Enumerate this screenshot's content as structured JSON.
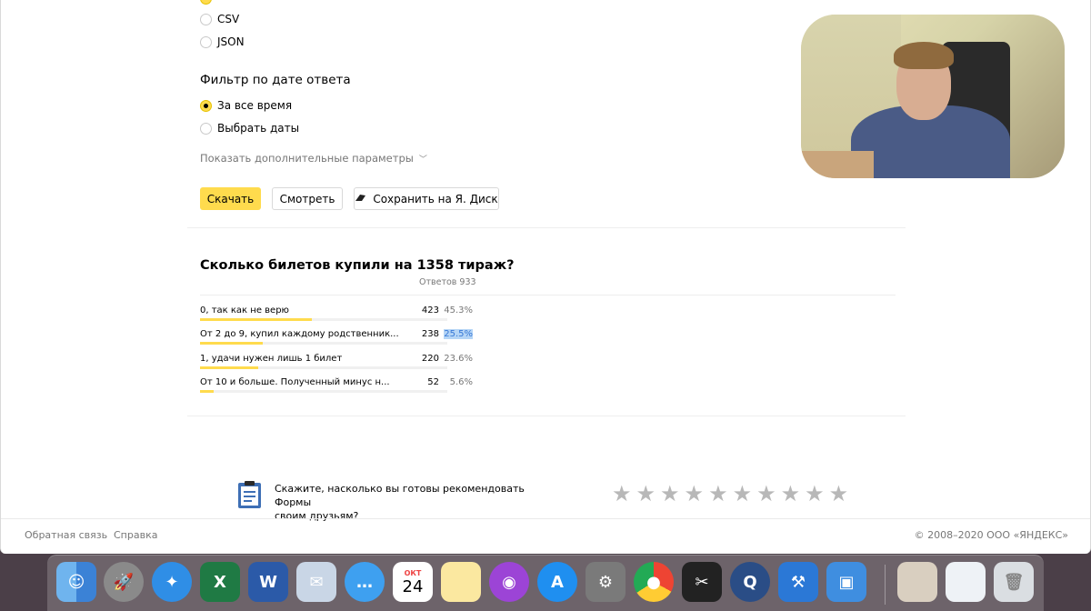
{
  "format_options": [
    {
      "label": "CSV",
      "checked": false
    },
    {
      "label": "JSON",
      "checked": false
    }
  ],
  "filter": {
    "title": "Фильтр по дате ответа",
    "options": [
      {
        "label": "За все время",
        "checked": true
      },
      {
        "label": "Выбрать даты",
        "checked": false
      }
    ],
    "more_params": "Показать дополнительные параметры"
  },
  "buttons": {
    "download": "Скачать",
    "view": "Смотреть",
    "save_disk": "Сохранить на Я. Диск"
  },
  "question": {
    "title": "Сколько билетов купили на 1358 тираж?",
    "count_label": "Ответов 933",
    "answers": [
      {
        "label": "0, так как не верю",
        "count": "423",
        "percent": "45.3%",
        "fraction": 0.453,
        "highlighted": false
      },
      {
        "label": "От 2 до 9, купил каждому родственник...",
        "count": "238",
        "percent": "25.5%",
        "fraction": 0.255,
        "highlighted": true
      },
      {
        "label": "1, удачи нужен лишь 1 билет",
        "count": "220",
        "percent": "23.6%",
        "fraction": 0.236,
        "highlighted": false
      },
      {
        "label": "От 10 и больше. Полученный минус н...",
        "count": "52",
        "percent": "5.6%",
        "fraction": 0.056,
        "highlighted": false
      }
    ]
  },
  "rating": {
    "prompt_line1": "Скажите, насколько вы готовы рекомендовать Формы",
    "prompt_line2": "своим друзьям?",
    "stars": 10
  },
  "footer": {
    "feedback": "Обратная связь",
    "help": "Справка",
    "copyright": "© 2008–2020 ООО «ЯНДЕКС»"
  },
  "dock": {
    "calendar_month": "ОКТ",
    "calendar_day": "24",
    "apps": [
      "finder-icon",
      "launchpad-icon",
      "safari-icon",
      "excel-icon",
      "word-icon",
      "preview-icon",
      "messages-icon",
      "calendar-icon",
      "notes-icon",
      "podcasts-icon",
      "app-store-icon",
      "system-preferences-icon",
      "chrome-icon",
      "final-cut-icon",
      "quicktime-icon",
      "xcode-icon",
      "simulator-icon",
      "downloads-stack-icon",
      "preview-stack-icon",
      "trash-icon"
    ]
  },
  "colors": {
    "accent": "#ffdb4d",
    "highlight": "#b5d5f6",
    "star_inactive": "#b8b8b8"
  }
}
